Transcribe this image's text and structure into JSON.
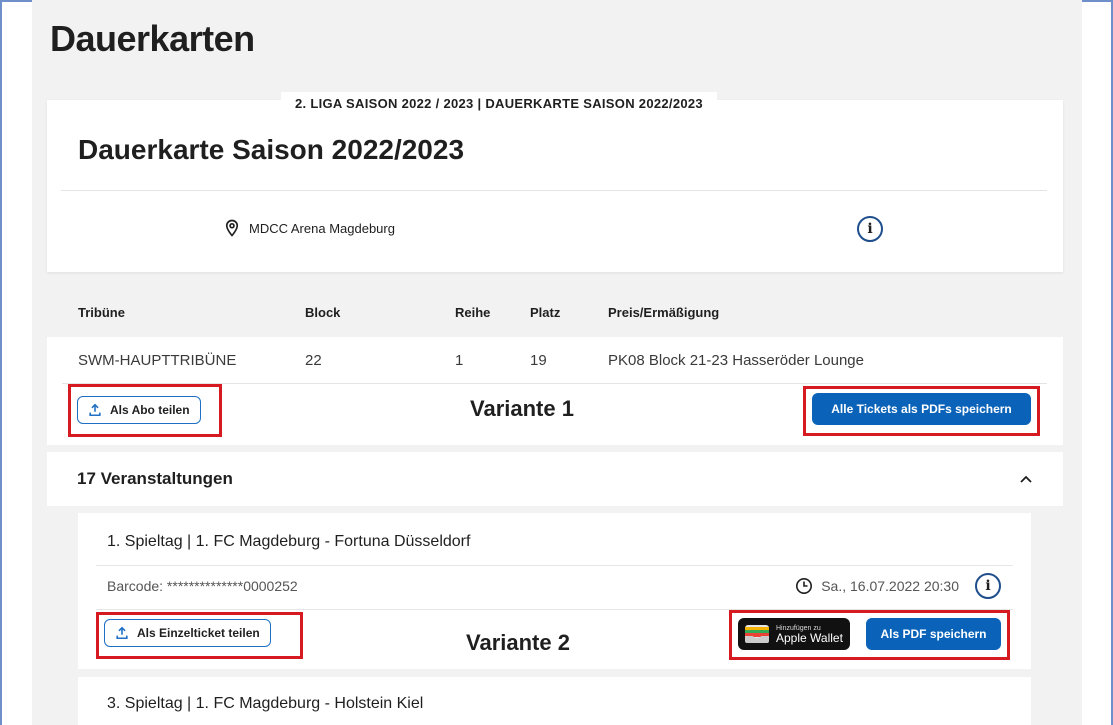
{
  "page": {
    "title": "Dauerkarten"
  },
  "event": {
    "tag": "2. LIGA SAISON 2022 / 2023 | DAUERKARTE SAISON 2022/2023",
    "name": "Dauerkarte Saison 2022/2023",
    "venue": "MDCC Arena Magdeburg",
    "info_icon": "info-icon"
  },
  "seat_table": {
    "headers": [
      "Tribüne",
      "Block",
      "Reihe",
      "Platz",
      "Preis/Ermäßigung"
    ],
    "row": [
      "SWM-HAUPTTRIBÜNE",
      "22",
      "1",
      "19",
      "PK08 Block 21-23 Hasseröder Lounge"
    ]
  },
  "variant1": {
    "share_label": "Als Abo teilen",
    "label": "Variante 1",
    "save_all_label": "Alle Tickets als PDFs speichern"
  },
  "events_section": {
    "count_label": "17 Veranstaltungen"
  },
  "matches": [
    {
      "title": "1. Spieltag | 1. FC Magdeburg - Fortuna Düsseldorf",
      "barcode": "Barcode: **************0000252",
      "datetime": "Sa., 16.07.2022 20:30"
    },
    {
      "title": "3. Spieltag | 1. FC Magdeburg - Holstein Kiel"
    }
  ],
  "variant2": {
    "share_label": "Als Einzelticket teilen",
    "label": "Variante 2",
    "wallet_small": "Hinzufügen zu",
    "wallet_big": "Apple Wallet",
    "save_pdf_label": "Als PDF speichern"
  },
  "colors": {
    "accent": "#0a63b9",
    "highlight": "#d71920",
    "frame": "#6e8fc9"
  }
}
